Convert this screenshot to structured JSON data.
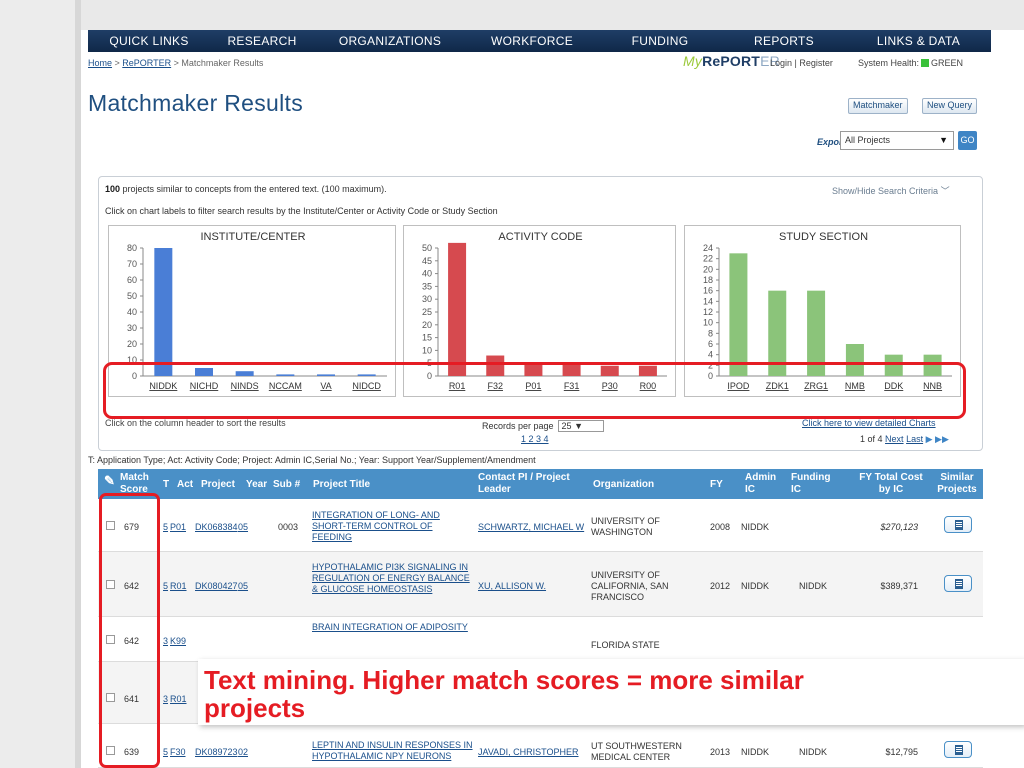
{
  "nav": [
    "QUICK LINKS",
    "RESEARCH",
    "ORGANIZATIONS",
    "WORKFORCE",
    "FUNDING",
    "REPORTS",
    "LINKS & DATA"
  ],
  "breadcrumb": {
    "home": "Home",
    "sep1": " > ",
    "reporter": "RePORTER",
    "sep2": " > ",
    "current": "Matchmaker Results"
  },
  "logo": {
    "my": "My",
    "re": "RePORT",
    "er": "ER"
  },
  "login": "Login |  Register",
  "health": {
    "label": "System Health:",
    "status": "GREEN"
  },
  "title": "Matchmaker Results",
  "buttons": {
    "matchmaker": "Matchmaker",
    "new_query": "New Query"
  },
  "export": {
    "label": "Export",
    "selected": "All Projects",
    "go": "GO"
  },
  "summary": {
    "count": "100",
    "text": " projects similar to concepts from the entered text. (100 maximum).",
    "showhide": "Show/Hide Search Criteria"
  },
  "hint": "Click on chart labels to filter search results by the Institute/Center or Activity Code or Study Section",
  "chart_data": [
    {
      "type": "bar",
      "title": "INSTITUTE/CENTER",
      "categories": [
        "NIDDK",
        "NICHD",
        "NINDS",
        "NCCAM",
        "VA",
        "NIDCD"
      ],
      "values": [
        80,
        5,
        3,
        1,
        1,
        1
      ],
      "ylim": [
        0,
        80
      ],
      "yticks": [
        0,
        10,
        20,
        30,
        40,
        50,
        60,
        70,
        80
      ],
      "color": "#4a7ed6"
    },
    {
      "type": "bar",
      "title": "ACTIVITY CODE",
      "categories": [
        "R01",
        "F32",
        "P01",
        "F31",
        "P30",
        "R00"
      ],
      "values": [
        52,
        8,
        5,
        5,
        4,
        4
      ],
      "ylim": [
        0,
        50
      ],
      "yticks": [
        0,
        5,
        10,
        15,
        20,
        25,
        30,
        35,
        40,
        45,
        50
      ],
      "color": "#d64a4f"
    },
    {
      "type": "bar",
      "title": "STUDY SECTION",
      "categories": [
        "IPOD",
        "ZDK1",
        "ZRG1",
        "NMB",
        "DDK",
        "NNB"
      ],
      "values": [
        23,
        16,
        16,
        6,
        4,
        4
      ],
      "ylim": [
        0,
        24
      ],
      "yticks": [
        0,
        2,
        4,
        6,
        8,
        10,
        12,
        14,
        16,
        18,
        20,
        22,
        24
      ],
      "color": "#8bc47a"
    }
  ],
  "sort_hint": "Click on the column header to sort the results",
  "records": {
    "label": "Records per page",
    "value": "25",
    "pages": "1 2 3 4"
  },
  "detail_link": "Click here to view detailed Charts",
  "page_nav": {
    "of": "1 of 4",
    "next": "Next",
    "last": "Last"
  },
  "legend": "T: Application Type; Act: Activity Code; Project: Admin IC,Serial No.; Year: Support Year/Supplement/Amendment",
  "columns": {
    "match": "Match Score",
    "t": "T",
    "act": "Act",
    "project": "Project",
    "year": "Year",
    "sub": "Sub #",
    "title": "Project Title",
    "pi": "Contact PI / Project Leader",
    "org": "Organization",
    "fy": "FY",
    "admin": "Admin IC",
    "funding": "Funding IC",
    "cost": "FY Total Cost by IC",
    "similar": "Similar Projects"
  },
  "rows": [
    {
      "score": "679",
      "t": "5",
      "act": "P01",
      "project": "DK068384",
      "year": "05",
      "sub": "0003",
      "title": "INTEGRATION OF LONG- AND SHORT-TERM CONTROL OF FEEDING",
      "pi": "SCHWARTZ, MICHAEL W",
      "org": "UNIVERSITY OF WASHINGTON",
      "fy": "2008",
      "admin": "NIDDK",
      "funding": "",
      "cost": "$270,123"
    },
    {
      "score": "642",
      "t": "5",
      "act": "R01",
      "project": "DK080427",
      "year": "05",
      "sub": "",
      "title": "HYPOTHALAMIC PI3K SIGNALING IN REGULATION OF ENERGY BALANCE & GLUCOSE HOMEOSTASIS",
      "pi": "XU, ALLISON W.",
      "org": "UNIVERSITY OF CALIFORNIA, SAN FRANCISCO",
      "fy": "2012",
      "admin": "NIDDK",
      "funding": "NIDDK",
      "cost": "$389,371"
    },
    {
      "score": "642",
      "t": "3",
      "act": "K99",
      "project": "",
      "year": "",
      "sub": "",
      "title": "BRAIN INTEGRATION OF ADIPOSITY",
      "pi": "",
      "org": "FLORIDA STATE",
      "fy": "",
      "admin": "",
      "funding": "",
      "cost": ""
    },
    {
      "score": "641",
      "t": "3",
      "act": "R01",
      "project": "",
      "year": "",
      "sub": "",
      "title": "",
      "pi": "",
      "org": "",
      "fy": "",
      "admin": "",
      "funding": "",
      "cost": ""
    },
    {
      "score": "639",
      "t": "5",
      "act": "F30",
      "project": "DK089723",
      "year": "02",
      "sub": "",
      "title": "LEPTIN AND INSULIN RESPONSES IN HYPOTHALAMIC NPY NEURONS",
      "pi": "JAVADI, CHRISTOPHER",
      "org": "UT SOUTHWESTERN MEDICAL CENTER",
      "fy": "2013",
      "admin": "NIDDK",
      "funding": "NIDDK",
      "cost": "$12,795"
    }
  ],
  "callout": {
    "line1": "Text mining. Higher match scores = more similar",
    "line2": "projects"
  },
  "colors": {
    "nav": "#1f3e66",
    "table_header": "#4a90c7",
    "highlight": "#e51c23",
    "title": "#1f4f80"
  }
}
